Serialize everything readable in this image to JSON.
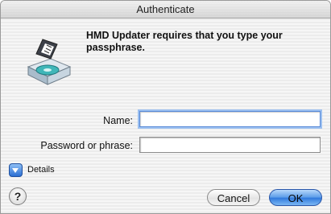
{
  "window": {
    "title": "Authenticate"
  },
  "message": "HMD Updater requires that you type your passphrase.",
  "form": {
    "name_label": "Name:",
    "name_value": "",
    "password_label": "Password or phrase:",
    "password_value": ""
  },
  "details": {
    "label": "Details"
  },
  "help": {
    "label": "?"
  },
  "buttons": {
    "cancel_label": "Cancel",
    "ok_label": "OK"
  },
  "icons": {
    "app": "installer-package-icon",
    "disclosure": "disclosure-triangle-icon",
    "help": "help-icon"
  },
  "colors": {
    "accent": "#3b82e0",
    "focus_ring": "#9cc0f0"
  }
}
